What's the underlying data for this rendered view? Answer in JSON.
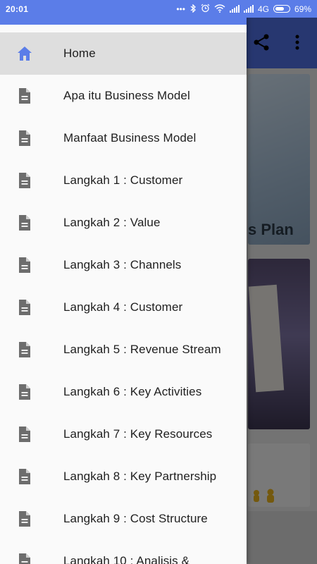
{
  "status_bar": {
    "time": "20:01",
    "network": "4G",
    "battery": "69%",
    "battery_level": 0.69,
    "icons": [
      "dots-icon",
      "bluetooth-icon",
      "alarm-icon",
      "wifi-icon",
      "signal-icon",
      "signal-icon",
      "battery-icon"
    ]
  },
  "colors": {
    "accent": "#5b7de8",
    "appbar": "#4f6fe0",
    "active_icon": "#5b7de8",
    "doc_icon": "#6d6d6d"
  },
  "background": {
    "card_caption": "s Plan"
  },
  "drawer": {
    "items": [
      {
        "label": "Home",
        "icon": "home-icon",
        "active": true
      },
      {
        "label": "Apa itu Business Model",
        "icon": "document-icon"
      },
      {
        "label": "Manfaat Business Model",
        "icon": "document-icon"
      },
      {
        "label": "Langkah 1 : Customer",
        "icon": "document-icon"
      },
      {
        "label": "Langkah 2 : Value",
        "icon": "document-icon"
      },
      {
        "label": "Langkah 3 : Channels",
        "icon": "document-icon"
      },
      {
        "label": "Langkah 4 : Customer",
        "icon": "document-icon"
      },
      {
        "label": "Langkah 5 : Revenue Stream",
        "icon": "document-icon"
      },
      {
        "label": "Langkah 6 : Key Activities",
        "icon": "document-icon"
      },
      {
        "label": "Langkah 7 : Key Resources",
        "icon": "document-icon"
      },
      {
        "label": "Langkah 8 : Key Partnership",
        "icon": "document-icon"
      },
      {
        "label": "Langkah 9 : Cost Structure",
        "icon": "document-icon"
      },
      {
        "label": "Langkah 10 : Analisis &",
        "icon": "document-icon"
      }
    ]
  }
}
